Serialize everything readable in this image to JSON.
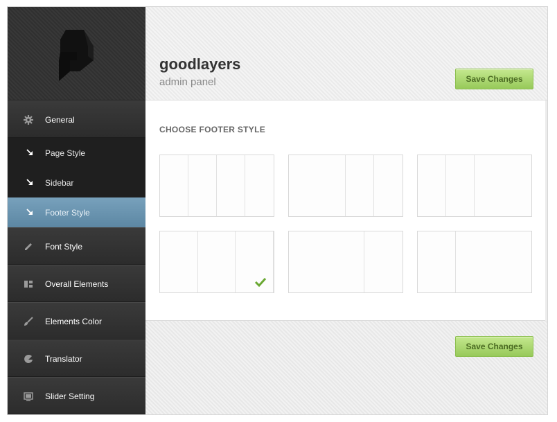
{
  "header": {
    "brand": "goodlayers",
    "subtitle": "admin panel",
    "save_label": "Save Changes"
  },
  "sidebar": {
    "items": [
      {
        "label": "General",
        "icon": "gear-icon"
      },
      {
        "label": "Page Style",
        "icon": "arrow-down-right-icon",
        "sub": true
      },
      {
        "label": "Sidebar",
        "icon": "arrow-down-right-icon",
        "sub": true
      },
      {
        "label": "Footer Style",
        "icon": "arrow-down-right-icon",
        "sub": true,
        "active": true
      },
      {
        "label": "Font Style",
        "icon": "pencil-icon"
      },
      {
        "label": "Overall Elements",
        "icon": "layout-icon"
      },
      {
        "label": "Elements Color",
        "icon": "brush-icon"
      },
      {
        "label": "Translator",
        "icon": "translator-icon"
      },
      {
        "label": "Slider Setting",
        "icon": "slider-icon"
      }
    ]
  },
  "main": {
    "section_title": "CHOOSE FOOTER STYLE",
    "footer_options": [
      {
        "columns": [
          1,
          1,
          1,
          1
        ],
        "selected": false
      },
      {
        "columns": [
          2,
          1,
          1
        ],
        "selected": false
      },
      {
        "columns": [
          1,
          1,
          2
        ],
        "selected": false
      },
      {
        "columns": [
          1,
          1,
          1
        ],
        "selected": true
      },
      {
        "columns": [
          2,
          1
        ],
        "selected": false
      },
      {
        "columns": [
          1,
          2
        ],
        "selected": false
      }
    ],
    "bottom_save_label": "Save Changes"
  },
  "colors": {
    "accent_green": "#a9d574",
    "active_blue": "#6a94b0",
    "sidebar_dark": "#2b2b2b"
  }
}
